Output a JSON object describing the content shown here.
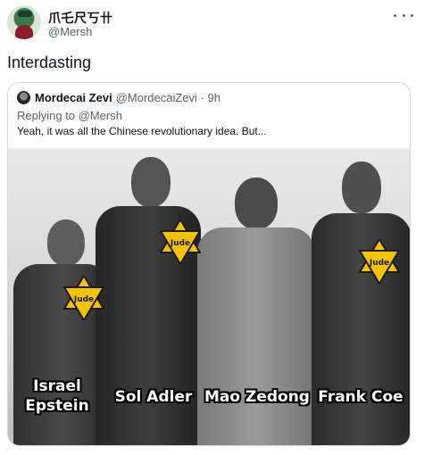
{
  "tweet": {
    "display_name": "爪乇尺丂卄",
    "handle": "@Mersh",
    "text": "Interdasting"
  },
  "quoted_tweet": {
    "author_name": "Mordecai Zevi",
    "author_handle_time": "@MordecaiZevi · 9h",
    "replying_to": "Replying to @Mersh",
    "text": "Yeah, it was all the Chinese revolutionary idea. But..."
  },
  "image": {
    "star_label": "Jude",
    "captions": {
      "person_1": "Israel Epstein",
      "person_2": "Sol Adler",
      "person_3": "Mao Zedong",
      "person_4": "Frank Coe"
    }
  },
  "colors": {
    "text_primary": "#0f1419",
    "text_secondary": "#536471",
    "border": "#cfd9de",
    "star_fill": "#f5c400"
  }
}
